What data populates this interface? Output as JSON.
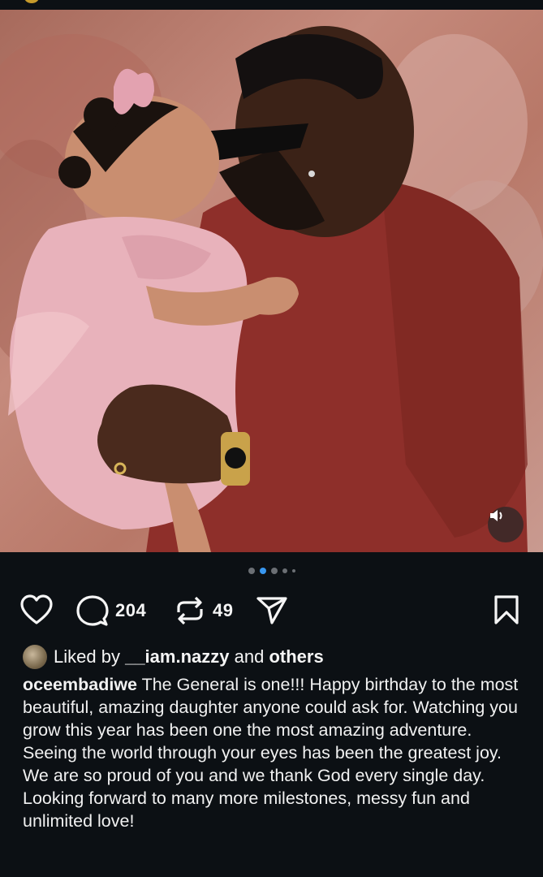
{
  "post": {
    "sound_icon": "speaker-icon",
    "carousel": {
      "total": 5,
      "active_index": 1
    },
    "actions": {
      "like_icon": "heart-icon",
      "comment_icon": "comment-bubble-icon",
      "comment_count": "204",
      "repost_icon": "repost-icon",
      "repost_count": "49",
      "share_icon": "send-icon",
      "save_icon": "bookmark-icon"
    },
    "likes": {
      "prefix": "Liked by",
      "user": "__iam.nazzy",
      "joiner": "and",
      "suffix": "others"
    },
    "caption": {
      "username": "oceembadiwe",
      "text": "The General is one!!! Happy birthday to the most beautiful, amazing daughter anyone could ask for. Watching you grow this year has been one the most amazing adventure.  Seeing the world through your eyes has been the greatest joy. We are so proud of you and we thank God every single day. Looking forward to many more milestones, messy fun and unlimited love!"
    }
  },
  "colors": {
    "background": "#0c1014",
    "text": "#f5f5f5",
    "active_dot": "#3897f0",
    "inactive_dot": "#6b6f74"
  }
}
